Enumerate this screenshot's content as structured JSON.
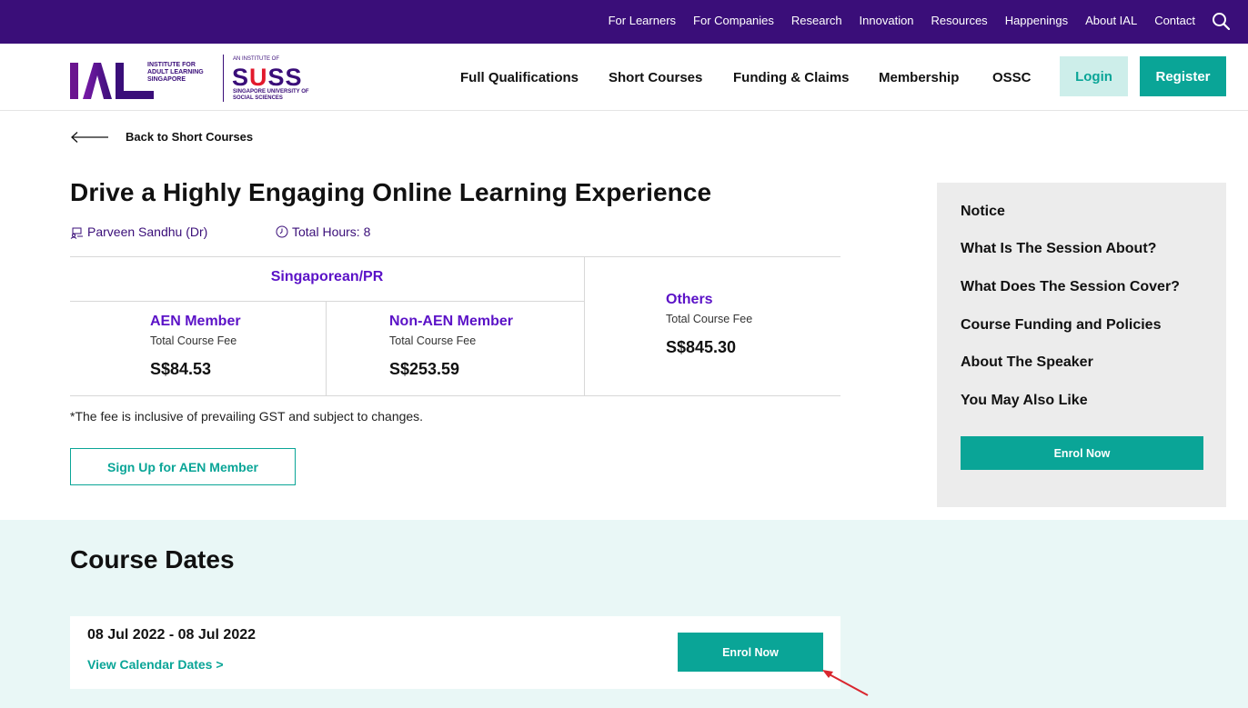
{
  "topbar": {
    "links": [
      "For Learners",
      "For Companies",
      "Research",
      "Innovation",
      "Resources",
      "Happenings",
      "About IAL",
      "Contact"
    ],
    "search_icon": "search-icon"
  },
  "logo": {
    "ial_text": "INSTITUTE FOR ADULT LEARNING SINGAPORE",
    "suss_small": "AN INSTITUTE OF",
    "suss_word_pre": "S",
    "suss_word_u": "U",
    "suss_word_post": "SS",
    "suss_sub": "SINGAPORE UNIVERSITY OF SOCIAL SCIENCES"
  },
  "mainnav": {
    "items": [
      "Full Qualifications",
      "Short Courses",
      "Funding & Claims",
      "Membership",
      "OSSC"
    ],
    "login": "Login",
    "register": "Register"
  },
  "back": {
    "label": "Back to Short Courses"
  },
  "course": {
    "title": "Drive a Highly Engaging Online Learning Experience",
    "speaker": "Parveen Sandhu (Dr)",
    "hours": "Total Hours: 8"
  },
  "fees": {
    "group_label": "Singaporean/PR",
    "cells": [
      {
        "name": "AEN Member",
        "sub": "Total Course Fee",
        "amount": "S$84.53"
      },
      {
        "name": "Non-AEN Member",
        "sub": "Total Course Fee",
        "amount": "S$253.59"
      },
      {
        "name": "Others",
        "sub": "Total Course Fee",
        "amount": "S$845.30"
      }
    ],
    "note": "*The fee is inclusive of prevailing GST and subject to changes."
  },
  "aen_button": "Sign Up for AEN Member",
  "sidebar": {
    "items": [
      "Notice",
      "What Is The Session About?",
      "What Does The Session Cover?",
      "Course Funding and Policies",
      "About The Speaker",
      "You May Also Like"
    ],
    "enrol": "Enrol Now"
  },
  "dates": {
    "heading": "Course Dates",
    "range": "08 Jul 2022 - 08 Jul 2022",
    "calendar_link": "View Calendar Dates >",
    "enrol": "Enrol Now"
  },
  "colors": {
    "brand_purple": "#3a0e79",
    "accent_teal": "#0aa597",
    "fee_purple": "#5b12c7",
    "band_bg": "#e9f7f6",
    "pointer_red": "#d9262e"
  }
}
